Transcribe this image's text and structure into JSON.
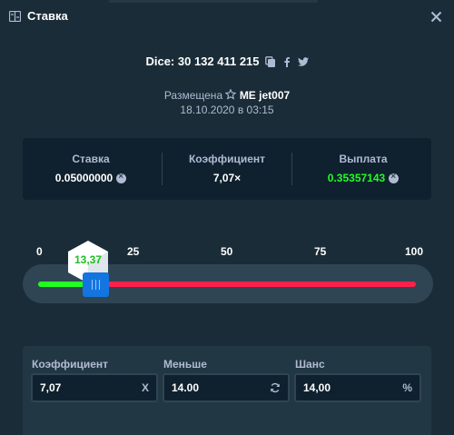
{
  "header": {
    "title": "Ставка",
    "icon": "bet-slip-icon",
    "close_icon": "close-icon"
  },
  "dice": {
    "label": "Dice: 30 132 411 215",
    "icons": [
      "copy-icon",
      "facebook-icon",
      "twitter-icon"
    ]
  },
  "placed": {
    "prefix": "Размещена",
    "badge_icon": "star-icon",
    "user": "ME jet007",
    "date": "18.10.2020 в 03:15"
  },
  "stats": {
    "bet_label": "Ставка",
    "bet_value": "0.05000000",
    "multiplier_label": "Коэффициент",
    "multiplier_value": "7,07×",
    "payout_label": "Выплата",
    "payout_value": "0.35357143",
    "currency_icon": "coin-icon"
  },
  "slider": {
    "ticks": [
      "0",
      "25",
      "50",
      "75",
      "100"
    ],
    "result": "13,37",
    "result_value": 13.37,
    "target_value": 14.0,
    "colors": {
      "win": "#1fff20",
      "lose": "#ff1f4b",
      "handle": "#1475e1"
    }
  },
  "controls": {
    "multiplier_label": "Коэффициент",
    "multiplier_value": "7,07",
    "multiplier_suffix": "X",
    "under_label": "Меньше",
    "under_value": "14.00",
    "under_icon": "refresh-icon",
    "chance_label": "Шанс",
    "chance_value": "14,00",
    "chance_suffix": "%"
  }
}
